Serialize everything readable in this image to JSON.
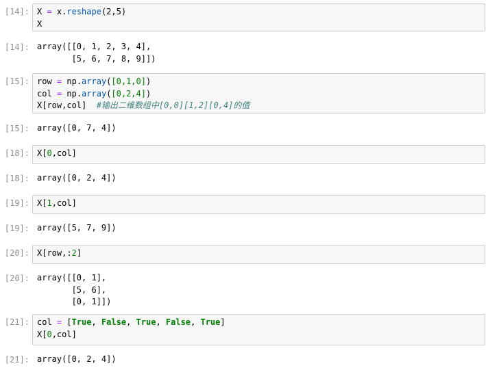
{
  "cells": [
    {
      "in_prompt": "[14]:",
      "code_lines": [
        [
          [
            "var",
            "X "
          ],
          [
            "op",
            "="
          ],
          [
            "var",
            " x."
          ],
          [
            "attr",
            "reshape"
          ],
          [
            "var",
            "(2,5)"
          ]
        ],
        [
          [
            "var",
            "X"
          ]
        ]
      ],
      "out_prompt": "[14]:",
      "output": "array([[0, 1, 2, 3, 4],\n       [5, 6, 7, 8, 9]])"
    },
    {
      "in_prompt": "[15]:",
      "code_lines": [
        [
          [
            "var",
            "row "
          ],
          [
            "op",
            "="
          ],
          [
            "var",
            " np."
          ],
          [
            "attr",
            "array"
          ],
          [
            "var",
            "("
          ],
          [
            "num",
            "[0,1,0]"
          ],
          [
            "var",
            ")"
          ]
        ],
        [
          [
            "var",
            "col "
          ],
          [
            "op",
            "="
          ],
          [
            "var",
            " np."
          ],
          [
            "attr",
            "array"
          ],
          [
            "var",
            "("
          ],
          [
            "num",
            "[0,2,4]"
          ],
          [
            "var",
            ")"
          ]
        ],
        [
          [
            "var",
            "X[row,col]  "
          ],
          [
            "comment",
            "#输出二维数组中[0,0][1,2][0,4]的值"
          ]
        ]
      ],
      "out_prompt": "[15]:",
      "output": "array([0, 7, 4])"
    },
    {
      "in_prompt": "[18]:",
      "code_lines": [
        [
          [
            "var",
            "X["
          ],
          [
            "num",
            "0"
          ],
          [
            "var",
            ",col]"
          ]
        ]
      ],
      "out_prompt": "[18]:",
      "output": "array([0, 2, 4])"
    },
    {
      "in_prompt": "[19]:",
      "code_lines": [
        [
          [
            "var",
            "X["
          ],
          [
            "num",
            "1"
          ],
          [
            "var",
            ",col]"
          ]
        ]
      ],
      "out_prompt": "[19]:",
      "output": "array([5, 7, 9])"
    },
    {
      "in_prompt": "[20]:",
      "code_lines": [
        [
          [
            "var",
            "X[row,:"
          ],
          [
            "num",
            "2"
          ],
          [
            "var",
            "]"
          ]
        ]
      ],
      "out_prompt": "[20]:",
      "output": "array([[0, 1],\n       [5, 6],\n       [0, 1]])"
    },
    {
      "in_prompt": "[21]:",
      "code_lines": [
        [
          [
            "var",
            "col "
          ],
          [
            "op",
            "="
          ],
          [
            "var",
            " ["
          ],
          [
            "kw",
            "True"
          ],
          [
            "var",
            ", "
          ],
          [
            "kw",
            "False"
          ],
          [
            "var",
            ", "
          ],
          [
            "kw",
            "True"
          ],
          [
            "var",
            ", "
          ],
          [
            "kw",
            "False"
          ],
          [
            "var",
            ", "
          ],
          [
            "kw",
            "True"
          ],
          [
            "var",
            "]"
          ]
        ],
        [
          [
            "var",
            "X["
          ],
          [
            "num",
            "0"
          ],
          [
            "var",
            ",col]"
          ]
        ]
      ],
      "out_prompt": "[21]:",
      "output": "array([0, 2, 4])"
    }
  ],
  "colors": {
    "prompt": "#909090",
    "input_bg": "#f7f7f7",
    "input_border": "#cfcfcf",
    "keyword": "#008000",
    "number": "#008000",
    "operator": "#aa22ff",
    "attribute": "#0055aa",
    "comment": "#408080"
  }
}
